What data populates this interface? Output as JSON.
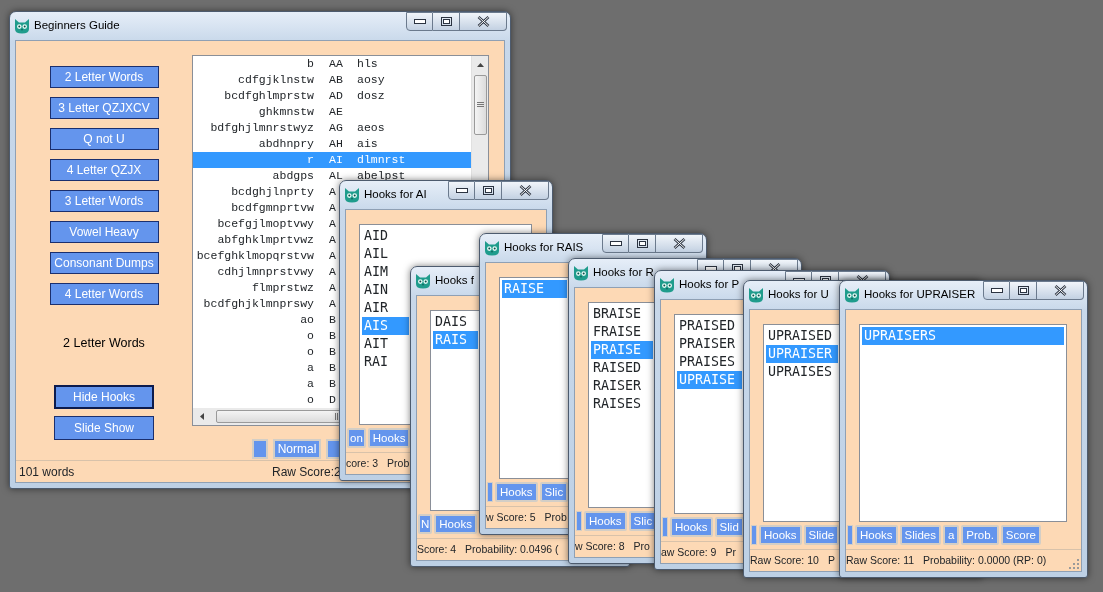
{
  "main_window": {
    "title": "Beginners Guide",
    "nav_buttons": [
      "2 Letter Words",
      "3 Letter QZJXCV",
      "Q not U",
      "4 Letter QZJX",
      "3 Letter Words",
      "Vowel Heavy",
      "Consonant Dumps",
      "4 Letter Words"
    ],
    "list_title": "2 Letter Words",
    "action_buttons": [
      {
        "label": "Hide Hooks",
        "focused": true
      },
      {
        "label": "Slide Show",
        "focused": false
      }
    ],
    "words": [
      {
        "front": "b",
        "word": "AA",
        "back": "hls",
        "selected": false
      },
      {
        "front": "cdfgjklnstw",
        "word": "AB",
        "back": "aosy",
        "selected": false
      },
      {
        "front": "bcdfghlmprstw",
        "word": "AD",
        "back": "dosz",
        "selected": false
      },
      {
        "front": "ghkmnstw",
        "word": "AE",
        "selected": false
      },
      {
        "front": "bdfghjlmnrstwyz",
        "word": "AG",
        "back": "aeos",
        "selected": false
      },
      {
        "front": "abdhnpry",
        "word": "AH",
        "back": "ais",
        "selected": false
      },
      {
        "front": "r",
        "word": "AI",
        "back": "dlmnrst",
        "selected": true
      },
      {
        "front": "abdgps",
        "word": "AL",
        "back": "abelpst",
        "selected": false
      },
      {
        "front": "bcdghjlnprty",
        "word": "A",
        "selected": false
      },
      {
        "front": "bcdfgmnprtvw",
        "word": "A",
        "selected": false
      },
      {
        "front": "bcefgjlmoptvwy",
        "word": "A",
        "selected": false
      },
      {
        "front": "abfghklmprtvwz",
        "word": "A",
        "selected": false
      },
      {
        "front": "bcefghklmopqrstvw",
        "word": "A",
        "selected": false
      },
      {
        "front": "cdhjlmnprstvwy",
        "word": "A",
        "selected": false
      },
      {
        "front": "flmprstwz",
        "word": "A",
        "selected": false
      },
      {
        "front": "bcdfghjklmnprswy",
        "word": "A",
        "selected": false
      },
      {
        "front": "ao",
        "word": "B",
        "selected": false
      },
      {
        "front": "o",
        "word": "B",
        "selected": false
      },
      {
        "front": "o",
        "word": "B",
        "selected": false
      },
      {
        "front": "a",
        "word": "B",
        "selected": false
      },
      {
        "front": "a",
        "word": "B",
        "selected": false
      },
      {
        "front": "o",
        "word": "D",
        "selected": false
      }
    ],
    "bottom_buttons": [
      {
        "kind": "blank"
      },
      {
        "kind": "text",
        "label": "Normal"
      },
      {
        "kind": "blank"
      }
    ],
    "status": [
      "101 words",
      "Raw Score:2"
    ]
  },
  "hook_windows": [
    {
      "title": "Hooks for AI",
      "items": [
        {
          "text": "AID",
          "selected": false
        },
        {
          "text": "AIL",
          "selected": false
        },
        {
          "text": "AIM",
          "selected": false
        },
        {
          "text": "AIN",
          "selected": false
        },
        {
          "text": "AIR",
          "selected": false
        },
        {
          "text": "AIS",
          "selected": true
        },
        {
          "text": "AIT",
          "selected": false
        },
        {
          "text": "RAI",
          "selected": false
        }
      ],
      "buttons": [
        {
          "kind": "text",
          "label": "on"
        },
        {
          "kind": "text",
          "label": "Hooks"
        }
      ],
      "status": [
        "core: 3",
        "Prob"
      ]
    },
    {
      "title": "Hooks f",
      "items": [
        {
          "text": "DAIS",
          "selected": false
        },
        {
          "text": "RAIS",
          "selected": true
        }
      ],
      "buttons": [
        {
          "kind": "text",
          "label": "N"
        },
        {
          "kind": "text",
          "label": "Hooks"
        }
      ],
      "status": [
        "Score: 4",
        "Probability: 0.0496 ("
      ]
    },
    {
      "title": "Hooks for RAIS",
      "items": [
        {
          "text": "RAISE",
          "selected": true
        }
      ],
      "buttons": [
        {
          "kind": "blank"
        },
        {
          "kind": "text",
          "label": "Hooks"
        },
        {
          "kind": "text",
          "label": "Slic"
        }
      ],
      "status": [
        "w Score: 5",
        "Prob"
      ]
    },
    {
      "title": "Hooks for R",
      "items": [
        {
          "text": "BRAISE",
          "selected": false
        },
        {
          "text": "FRAISE",
          "selected": false
        },
        {
          "text": "PRAISE",
          "selected": true
        },
        {
          "text": "RAISED",
          "selected": false
        },
        {
          "text": "RAISER",
          "selected": false
        },
        {
          "text": "RAISES",
          "selected": false
        }
      ],
      "buttons": [
        {
          "kind": "blank"
        },
        {
          "kind": "text",
          "label": "Hooks"
        },
        {
          "kind": "text",
          "label": "Slic"
        }
      ],
      "status": [
        "w Score: 8",
        "Pro"
      ]
    },
    {
      "title": "Hooks for P",
      "items": [
        {
          "text": "PRAISED",
          "selected": false
        },
        {
          "text": "PRAISER",
          "selected": false
        },
        {
          "text": "PRAISES",
          "selected": false
        },
        {
          "text": "UPRAISE",
          "selected": true
        }
      ],
      "buttons": [
        {
          "kind": "blank"
        },
        {
          "kind": "text",
          "label": "Hooks"
        },
        {
          "kind": "text",
          "label": "Slid"
        }
      ],
      "status": [
        "aw Score: 9",
        "Pr"
      ]
    },
    {
      "title": "Hooks for U",
      "items": [
        {
          "text": "UPRAISED",
          "selected": false
        },
        {
          "text": "UPRAISER",
          "selected": true
        },
        {
          "text": "UPRAISES",
          "selected": false
        }
      ],
      "buttons": [
        {
          "kind": "blank"
        },
        {
          "kind": "text",
          "label": "Hooks"
        },
        {
          "kind": "text",
          "label": "Slide"
        }
      ],
      "status": [
        "Raw Score: 10",
        "P"
      ]
    },
    {
      "title": "Hooks for UPRAISER",
      "items": [
        {
          "text": "UPRAISERS",
          "selected": true
        }
      ],
      "buttons": [
        {
          "kind": "blank"
        },
        {
          "kind": "text",
          "label": "Hooks"
        },
        {
          "kind": "text",
          "label": "Slides"
        },
        {
          "kind": "text",
          "label": "a"
        },
        {
          "kind": "text",
          "label": "Prob."
        },
        {
          "kind": "text",
          "label": "Score"
        }
      ],
      "status": [
        "Raw Score: 11",
        "Probability: 0.0000 (RP: 0)"
      ]
    }
  ]
}
